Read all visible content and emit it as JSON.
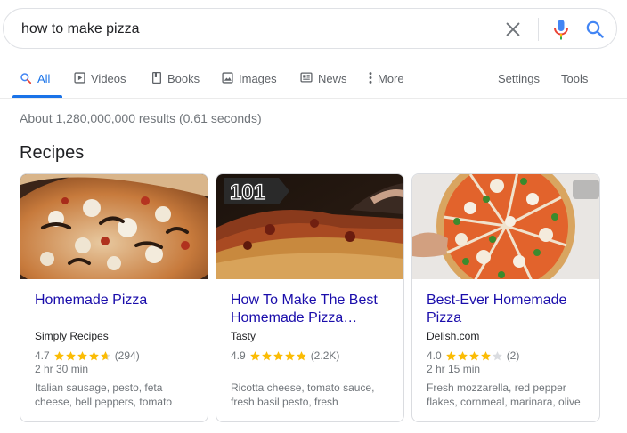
{
  "search": {
    "query": "how to make pizza"
  },
  "tabs": [
    {
      "label": "All",
      "icon": "search-icon",
      "active": true
    },
    {
      "label": "Videos",
      "icon": "video-icon"
    },
    {
      "label": "Books",
      "icon": "book-icon"
    },
    {
      "label": "Images",
      "icon": "image-icon"
    },
    {
      "label": "News",
      "icon": "news-icon"
    },
    {
      "label": "More",
      "icon": "more-vert-icon"
    }
  ],
  "tools": {
    "settings": "Settings",
    "tools": "Tools"
  },
  "result_stats": "About 1,280,000,000 results (0.61 seconds)",
  "section_title": "Recipes",
  "recipes": [
    {
      "title": "Homemade Pizza",
      "source": "Simply Recipes",
      "rating": "4.7",
      "rating_value": 4.7,
      "reviews": "(294)",
      "time": "2 hr 30 min",
      "ingredients": "Italian sausage, pesto, feta cheese, bell peppers, tomato"
    },
    {
      "title": "How To Make The Best Homemade Pizza…",
      "source": "Tasty",
      "rating": "4.9",
      "rating_value": 4.9,
      "reviews": "(2.2K)",
      "time": "",
      "ingredients": "Ricotta cheese, tomato sauce, fresh basil pesto, fresh",
      "image_badge": "101"
    },
    {
      "title": "Best-Ever Homemade Pizza",
      "source": "Delish.com",
      "rating": "4.0",
      "rating_value": 4.0,
      "reviews": "(2)",
      "time": "2 hr 15 min",
      "ingredients": "Fresh mozzarella, red pepper flakes, cornmeal, marinara, olive"
    }
  ],
  "colors": {
    "link": "#1a0dab",
    "accent": "#1a73e8",
    "star": "#fbbc04",
    "star_empty": "#dadce0",
    "muted": "#70757a"
  }
}
